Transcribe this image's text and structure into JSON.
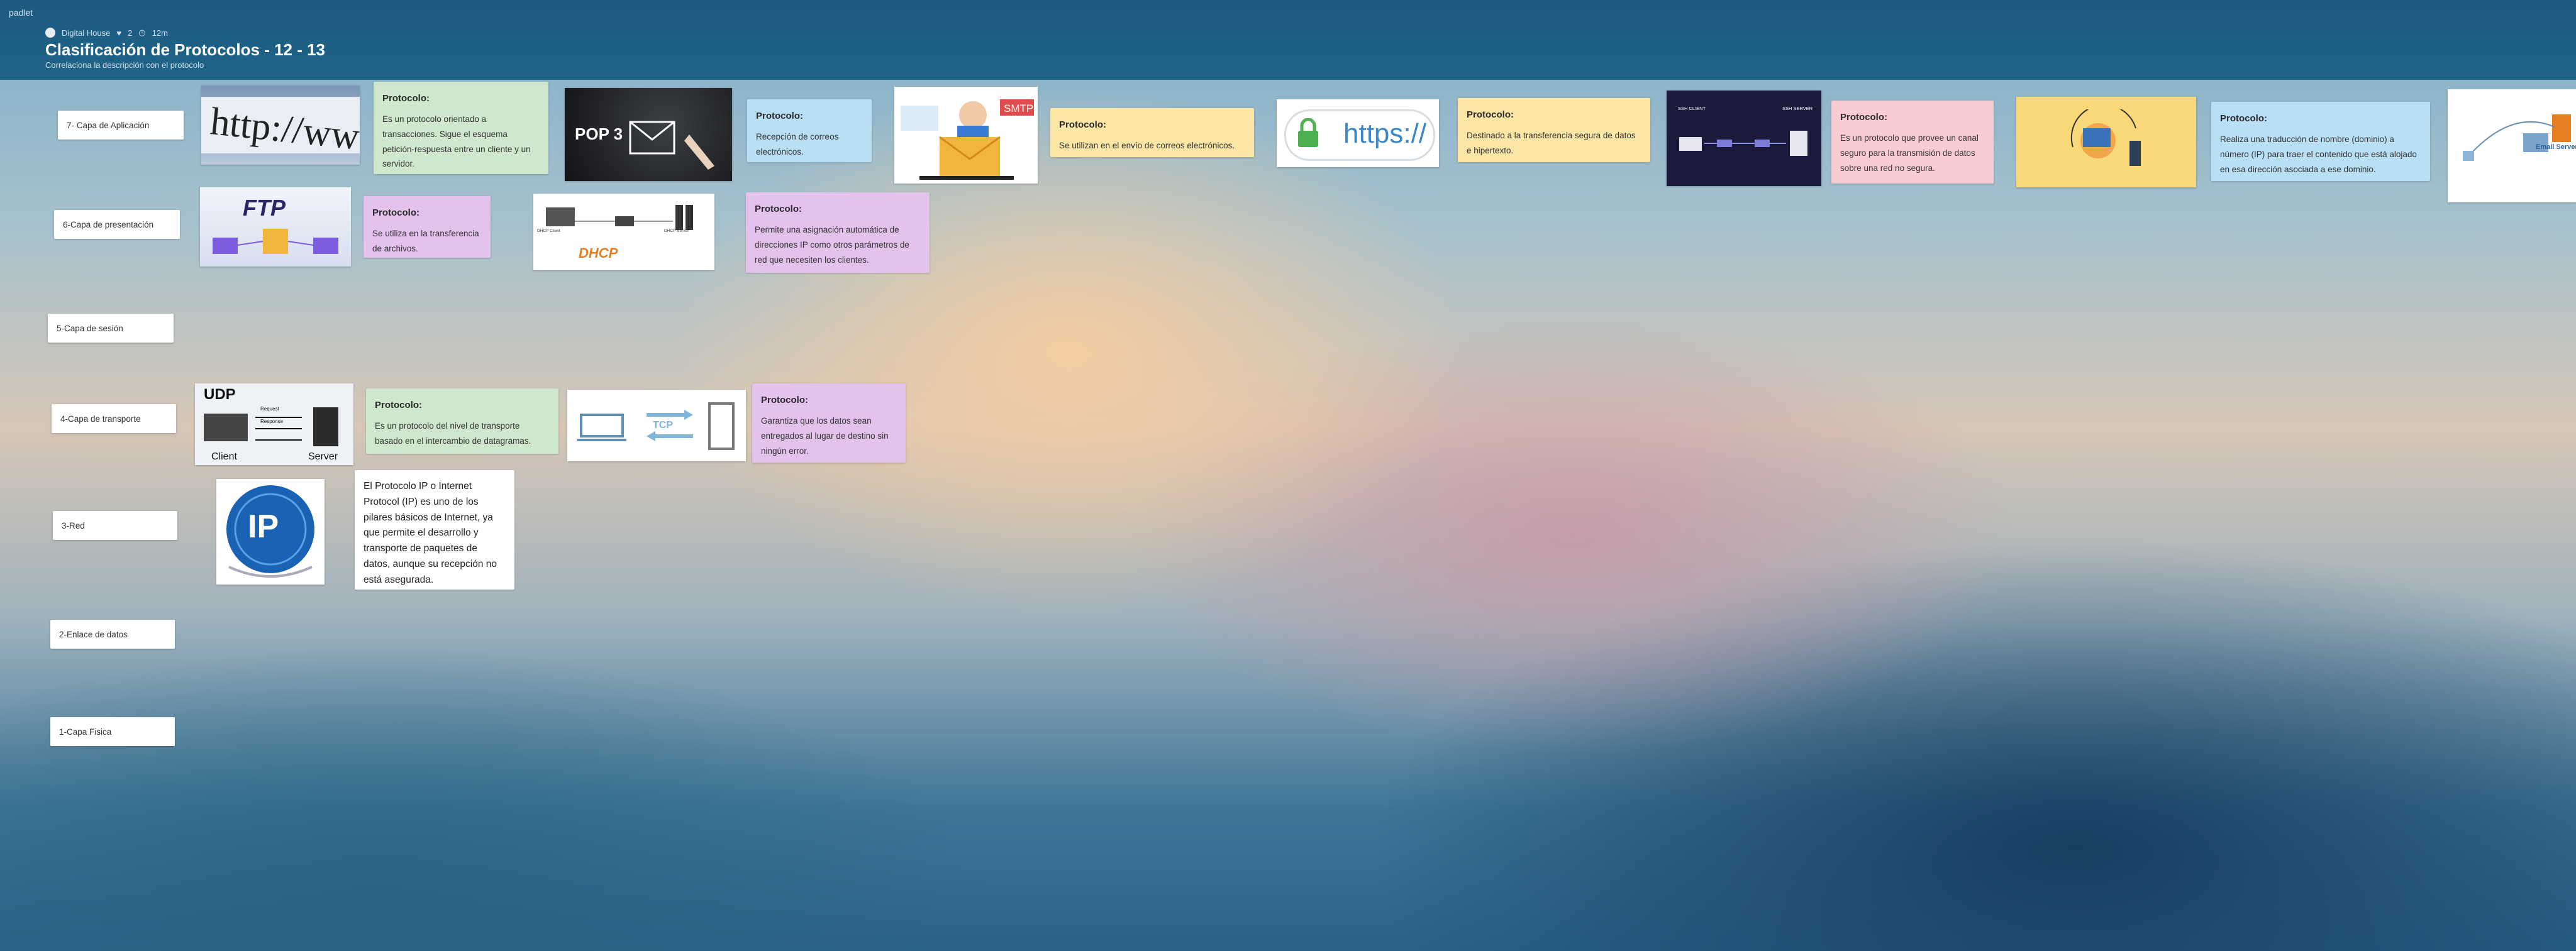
{
  "app": {
    "brand": "padlet"
  },
  "header": {
    "author": "Digital House",
    "likes": "2",
    "time": "12m",
    "title": "Clasificación de Protocolos - 12 - 13",
    "subtitle": "Correlaciona la descripción con el protocolo"
  },
  "layers": [
    "7- Capa de Aplicación",
    "6-Capa de presentación",
    "5-Capa de sesión",
    "4-Capa de transporte",
    "3-Red",
    "2-Enlace de datos",
    "1-Capa Fisica"
  ],
  "images": {
    "http": "http://www",
    "pop3": "POP 3",
    "smtp": "SMTP",
    "https": "https://",
    "ssh_client": "SSH CLIENT",
    "ssh_server": "SSH SERVER",
    "ftp": "FTP",
    "dhcp": "DHCP",
    "dhcp_client": "DHCP Client",
    "dhcp_server": "DHCP Server",
    "udp": "UDP",
    "udp_request": "Request",
    "udp_response": "Response",
    "udp_client": "Client",
    "udp_server": "Server",
    "tcp": "TCP",
    "ip": "IP",
    "dns_email": "Email Server"
  },
  "cards": {
    "c1": {
      "title": "Protocolo:",
      "text": "Es un protocolo orientado a transacciones. Sigue el esquema petición-respuesta entre un cliente y un servidor."
    },
    "c2": {
      "title": "Protocolo:",
      "text": "Recepción de correos electrónicos."
    },
    "c3": {
      "title": "Protocolo:",
      "text": "Se utilizan en el envío de correos electrónicos."
    },
    "c4": {
      "title": "Protocolo:",
      "text": "Destinado a la transferencia segura de datos e hipertexto."
    },
    "c5": {
      "title": "Protocolo:",
      "text": "Es un protocolo que provee un canal seguro para la transmisión de datos sobre una red no segura."
    },
    "c6": {
      "title": "Protocolo:",
      "text": "Realiza una traducción de nombre (dominio) a número (IP) para traer el contenido que está alojado en esa dirección asociada a ese dominio."
    },
    "c7": {
      "title": "Protocolo:",
      "text": "Se utiliza en la transferencia de archivos."
    },
    "c8": {
      "title": "Protocolo:",
      "text": "Permite una asignación automática de direcciones IP como otros parámetros de red que necesiten los clientes."
    },
    "c9": {
      "title": "Protocolo:",
      "text": "Es un protocolo del nivel de transporte basado en el intercambio de datagramas."
    },
    "c10": {
      "title": "Protocolo:",
      "text": "Garantiza que los datos sean entregados al lugar de destino sin ningún error."
    },
    "c11": {
      "text": "El Protocolo IP o Internet Protocol (IP) es uno de los pilares básicos de Internet, ya que permite el desarrollo y transporte de paquetes de datos, aunque su recepción no está asegurada."
    }
  }
}
